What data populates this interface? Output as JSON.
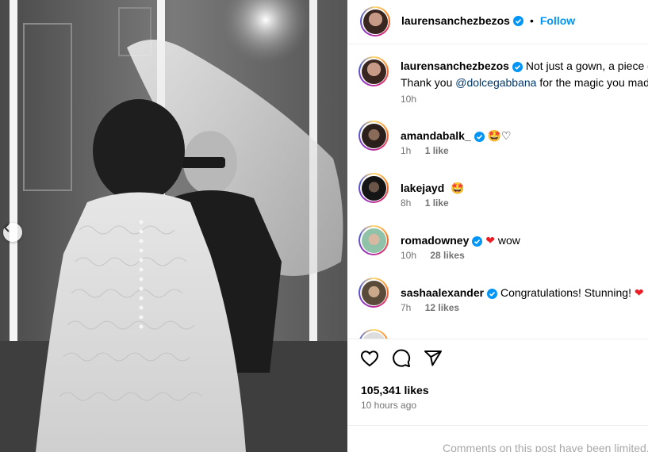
{
  "post": {
    "author": "laurensanchezbezos",
    "follow_label": "Follow",
    "separator": "•",
    "caption_text": "Not just a gown, a piece of",
    "caption_thanks": "Thank you",
    "caption_mention": "@dolcegabbana",
    "caption_rest": "for the magic you mad",
    "caption_time": "10h",
    "likes": "105,341 likes",
    "posted": "10 hours ago",
    "comments_notice": "Comments on this post have been limited."
  },
  "comments": [
    {
      "user": "amandabalk_",
      "verified": true,
      "text": "",
      "emoji": "🤩♡",
      "time": "1h",
      "likes": "1 like"
    },
    {
      "user": "lakejayd",
      "verified": false,
      "text": "",
      "emoji": "🤩",
      "time": "8h",
      "likes": "1 like"
    },
    {
      "user": "romadowney",
      "verified": true,
      "text": "wow",
      "emoji": "❤",
      "time": "10h",
      "likes": "28 likes"
    },
    {
      "user": "sashaalexander",
      "verified": true,
      "text": "Congratulations! Stunning!",
      "emoji": "❤",
      "time": "7h",
      "likes": "12 likes"
    },
    {
      "user": "",
      "verified": true,
      "text": "",
      "emoji": "❤❤❤❤❤❤❤❤",
      "time": "",
      "likes": ""
    }
  ],
  "icons": {
    "like": "heart-outline-icon",
    "comment": "speech-bubble-icon",
    "share": "paper-plane-icon",
    "verified": "verified-badge-icon",
    "prev": "chevron-left-icon"
  },
  "colors": {
    "accent": "#0095f6",
    "verified": "#0095f6",
    "mention": "#00376b",
    "heart": "#ed1c24",
    "meta": "#737373"
  }
}
